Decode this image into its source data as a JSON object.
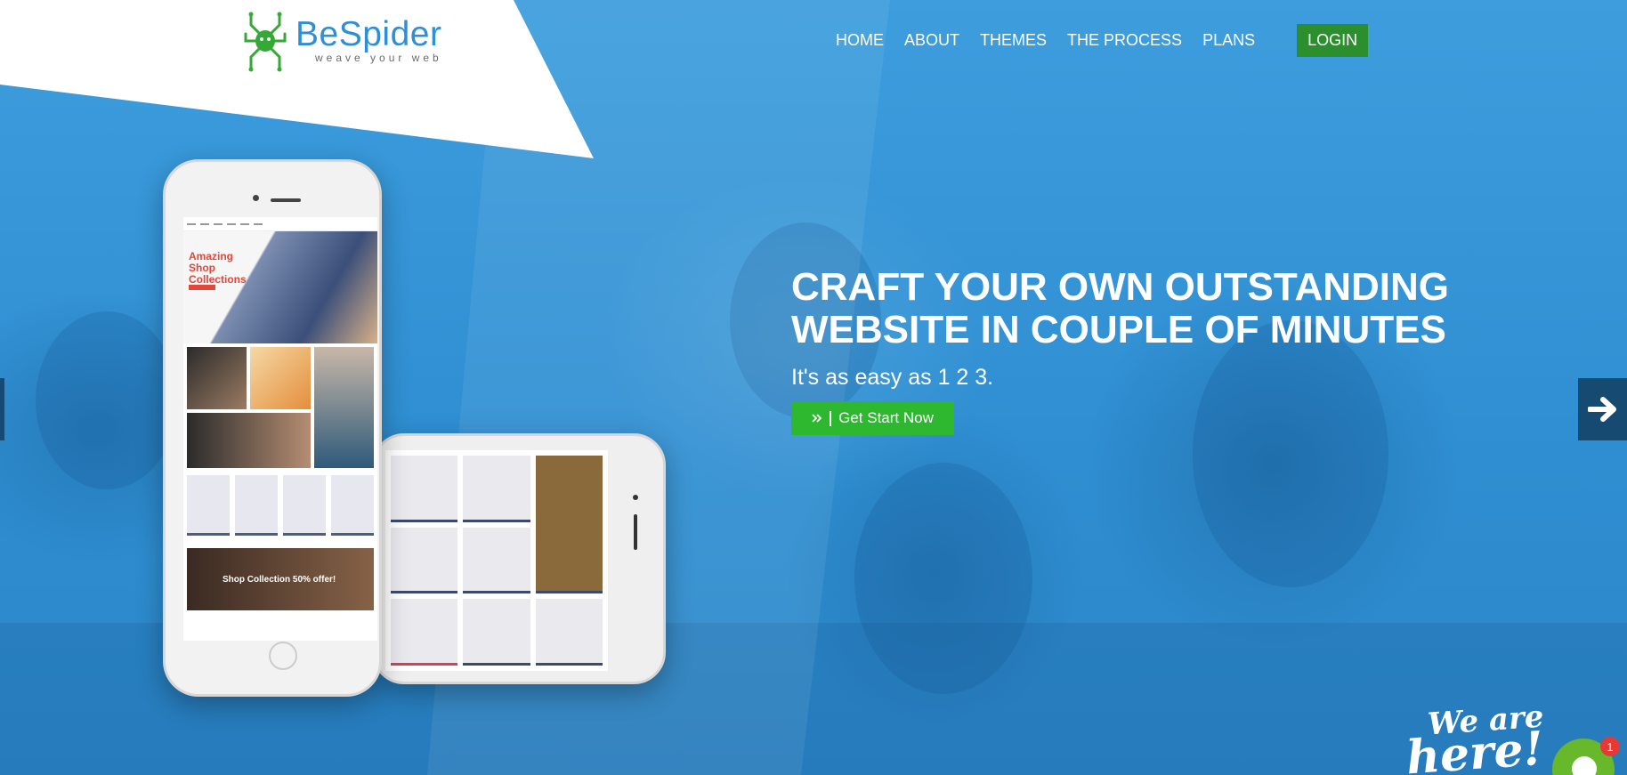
{
  "brand": {
    "name": "BeSpider",
    "tagline": "weave your web",
    "logo_icon": "spider-icon",
    "colors": {
      "primary_blue": "#3594d6",
      "logo_green": "#35a935",
      "login_green": "#2c8f2d",
      "cta_green": "#2eb830"
    }
  },
  "nav": {
    "items": [
      {
        "label": "HOME"
      },
      {
        "label": "ABOUT"
      },
      {
        "label": "THEMES"
      },
      {
        "label": "THE PROCESS"
      },
      {
        "label": "PLANS"
      }
    ],
    "login_label": "LOGIN"
  },
  "hero": {
    "headline_line1": "CRAFT YOUR OWN OUTSTANDING",
    "headline_line2": "WEBSITE IN COUPLE OF MINUTES",
    "subheadline": "It's as easy as 1 2 3.",
    "cta_icon": "double-chevron-right-icon",
    "cta_label": "Get Start Now",
    "next_icon": "arrow-right-icon"
  },
  "mockup": {
    "banner_title": "Amazing Shop Collections",
    "promo_text": "Shop Collection 50% offer!"
  },
  "chat_widget": {
    "text_line1": "We are",
    "text_line2": "here!",
    "icon": "chat-icon",
    "unread_count": "1"
  }
}
